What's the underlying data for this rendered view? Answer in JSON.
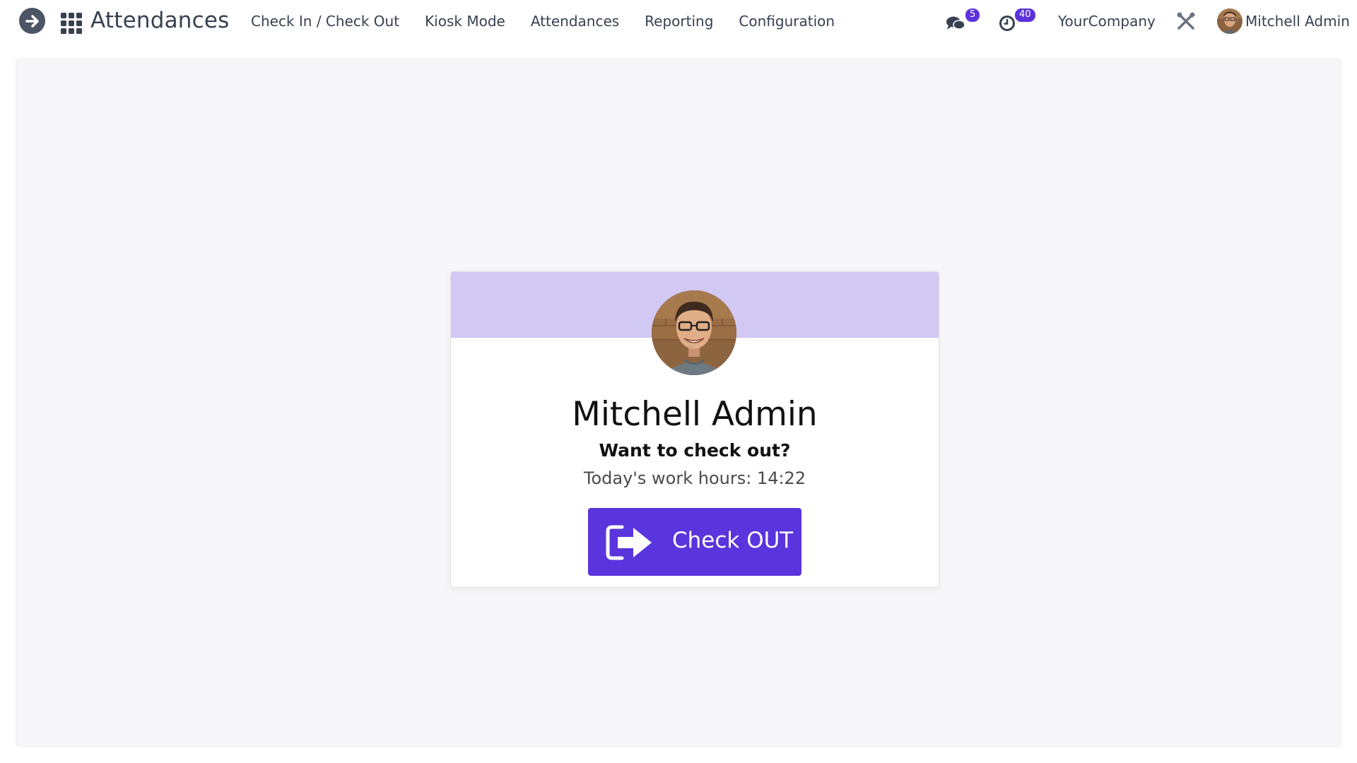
{
  "navbar": {
    "app_title": "Attendances",
    "menu": [
      {
        "label": "Check In / Check Out"
      },
      {
        "label": "Kiosk Mode"
      },
      {
        "label": "Attendances"
      },
      {
        "label": "Reporting"
      },
      {
        "label": "Configuration"
      }
    ],
    "messages_count": "5",
    "activities_count": "40",
    "company": "YourCompany",
    "user_name": "Mitchell Admin"
  },
  "card": {
    "employee_name": "Mitchell Admin",
    "question": "Want to check out?",
    "work_hours": "Today's work hours: 14:22",
    "button_label": "Check OUT"
  },
  "colors": {
    "accent": "#5a34dc",
    "header_band": "#d2c8f4",
    "badge": "#5b33d9"
  },
  "icons": [
    "back-arrow-icon",
    "apps-grid-icon",
    "chat-icon",
    "clock-icon",
    "tools-icon",
    "sign-out-icon"
  ]
}
